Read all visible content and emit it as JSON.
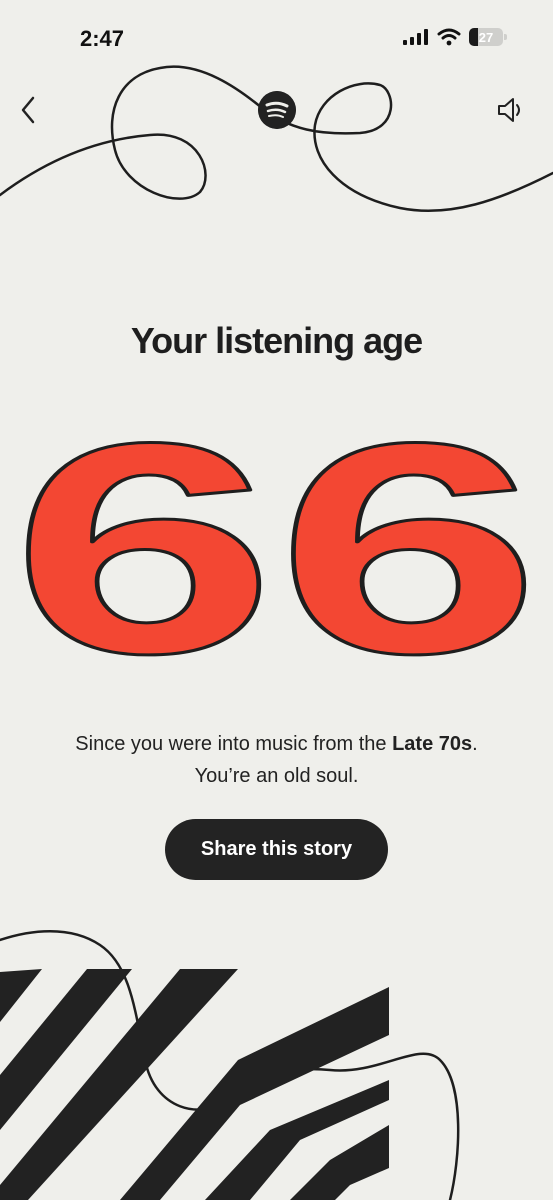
{
  "status": {
    "time": "2:47",
    "battery": "27",
    "battery_level": 0.27
  },
  "nav": {
    "back_icon": "chevron-left-icon",
    "logo_icon": "spotify-logo-icon",
    "sound_icon": "speaker-icon"
  },
  "story": {
    "heading": "Your listening age",
    "age": "66",
    "caption_prefix": "Since you were into music from the ",
    "caption_bold": "Late 70s",
    "caption_suffix": ".",
    "caption_line2": "You’re an old soul.",
    "share_label": "Share this story"
  },
  "colors": {
    "background": "#efefeb",
    "accent_red": "#f34733",
    "dark": "#232323"
  }
}
